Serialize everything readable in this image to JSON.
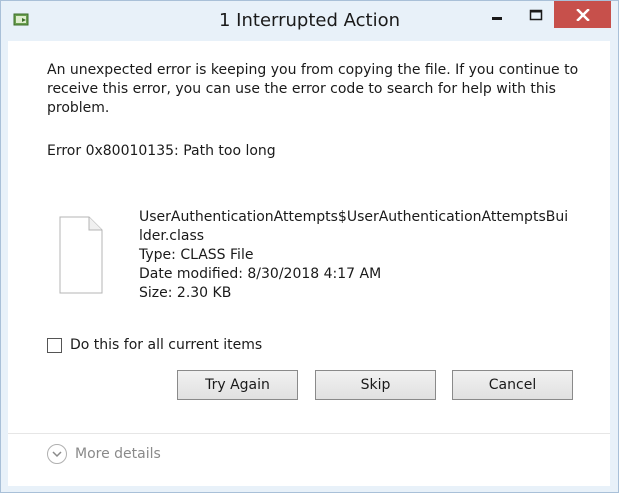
{
  "window": {
    "title": "1 Interrupted Action",
    "close_color": "#c7504b",
    "minimize_icon": "minimize-icon",
    "maximize_icon": "maximize-icon",
    "close_icon": "close-icon",
    "app_icon": "copy-file-icon"
  },
  "message": "An unexpected error is keeping you from copying the file. If you continue to receive this error, you can use the error code to search for help with this problem.",
  "error_line": "Error 0x80010135: Path too long",
  "file": {
    "icon": "document-icon",
    "name_line1": "UserAuthenticationAttempts$UserAuthenticationAttemptsBui",
    "name_line2": "lder.class",
    "type": "Type: CLASS File",
    "date_modified": "Date modified: 8/30/2018 4:17 AM",
    "size": "Size: 2.30 KB"
  },
  "checkbox": {
    "label": "Do this for all current items",
    "checked": false
  },
  "buttons": {
    "try_again": "Try Again",
    "skip": "Skip",
    "cancel": "Cancel"
  },
  "footer": {
    "more_details": "More details",
    "icon": "chevron-down-icon"
  }
}
